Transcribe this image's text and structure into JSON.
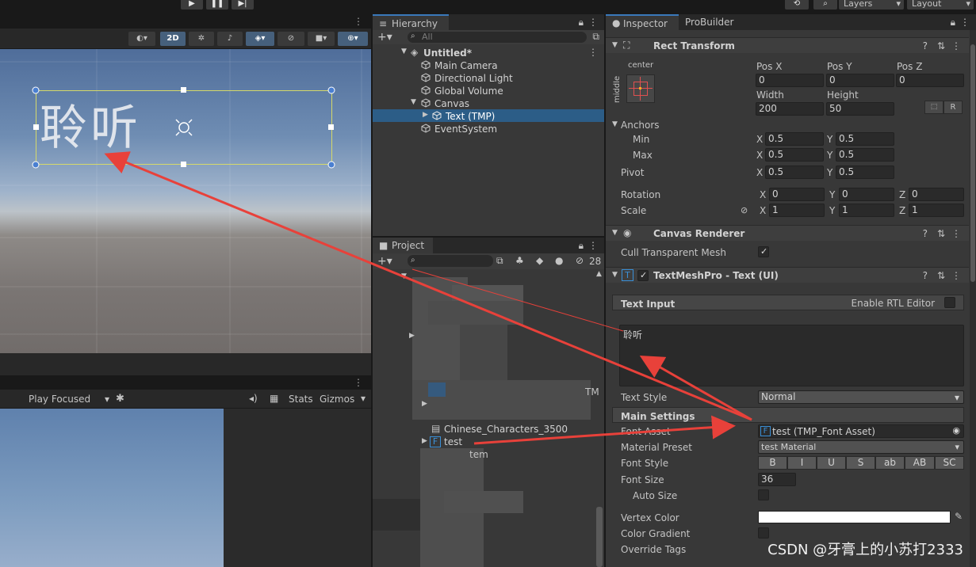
{
  "toolbar": {
    "play_icon": "play-icon",
    "pause_icon": "pause-icon",
    "step_icon": "step-icon",
    "history_icon": "history-icon",
    "search_icon": "search-icon",
    "layers_label": "Layers",
    "layout_label": "Layout"
  },
  "scene": {
    "toggle_2d": "2D",
    "canvas_text": "聆听"
  },
  "game": {
    "play_mode": "Play Focused",
    "stats": "Stats",
    "gizmos": "Gizmos"
  },
  "hierarchy": {
    "tab": "Hierarchy",
    "search_placeholder": "All",
    "scene_name": "Untitled*",
    "items": [
      {
        "label": "Main Camera"
      },
      {
        "label": "Directional Light"
      },
      {
        "label": "Global Volume"
      },
      {
        "label": "Canvas"
      },
      {
        "label": "Text (TMP)"
      },
      {
        "label": "EventSystem"
      }
    ]
  },
  "project": {
    "tab": "Project",
    "hidden_count": "28",
    "items": [
      {
        "label": "Chinese_Characters_3500"
      },
      {
        "label": "test"
      }
    ],
    "partial": [
      "tem",
      "TM"
    ]
  },
  "inspector": {
    "tabs": [
      "Inspector",
      "ProBuilder"
    ],
    "rect_transform": {
      "title": "Rect Transform",
      "anchor_h": "center",
      "anchor_v": "middle",
      "pos_x_label": "Pos X",
      "pos_y_label": "Pos Y",
      "pos_z_label": "Pos Z",
      "pos_x": "0",
      "pos_y": "0",
      "pos_z": "0",
      "width_label": "Width",
      "height_label": "Height",
      "width": "200",
      "height": "50",
      "r_label": "R",
      "anchors_label": "Anchors",
      "min_label": "Min",
      "max_label": "Max",
      "pivot_label": "Pivot",
      "min_x": "0.5",
      "min_y": "0.5",
      "max_x": "0.5",
      "max_y": "0.5",
      "pivot_x": "0.5",
      "pivot_y": "0.5",
      "rotation_label": "Rotation",
      "scale_label": "Scale",
      "rot_x": "0",
      "rot_y": "0",
      "rot_z": "0",
      "scale_x": "1",
      "scale_y": "1",
      "scale_z": "1",
      "axis_x": "X",
      "axis_y": "Y",
      "axis_z": "Z"
    },
    "canvas_renderer": {
      "title": "Canvas Renderer",
      "cull_label": "Cull Transparent Mesh",
      "cull_checked": true
    },
    "tmp": {
      "title": "TextMeshPro - Text (UI)",
      "text_input_label": "Text Input",
      "rtl_label": "Enable RTL Editor",
      "text_value": "聆听",
      "text_style_label": "Text Style",
      "text_style": "Normal",
      "main_settings_label": "Main Settings",
      "font_asset_label": "Font Asset",
      "font_asset": "test (TMP_Font Asset)",
      "material_preset_label": "Material Preset",
      "material_preset": "test Material",
      "font_style_label": "Font Style",
      "font_style_buttons": [
        "B",
        "I",
        "U",
        "S",
        "ab",
        "AB",
        "SC"
      ],
      "font_size_label": "Font Size",
      "font_size": "36",
      "auto_size_label": "Auto Size",
      "vertex_color_label": "Vertex Color",
      "vertex_color": "#ffffff",
      "color_gradient_label": "Color Gradient",
      "override_tags_label": "Override Tags"
    }
  },
  "watermark": "CSDN @牙膏上的小苏打2333",
  "colors": {
    "selection": "#2c5d87",
    "annotation_arrow": "#e8413a",
    "rect_outline": "#d6d96a",
    "handle": "#4a7fd1"
  }
}
